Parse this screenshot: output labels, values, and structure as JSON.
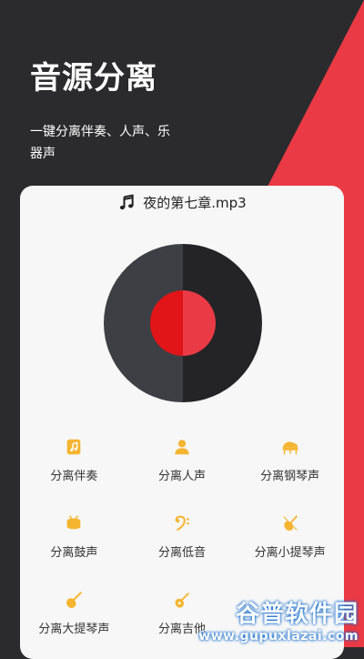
{
  "hero": {
    "title": "音源分离",
    "subtitle": "一键分离伴奏、人声、乐器声"
  },
  "file": {
    "icon": "music-note-icon",
    "name": "夜的第七章.mp3"
  },
  "options": [
    {
      "label": "分离伴奏",
      "icon": "music-file-icon"
    },
    {
      "label": "分离人声",
      "icon": "person-icon"
    },
    {
      "label": "分离钢琴声",
      "icon": "piano-icon"
    },
    {
      "label": "分离鼓声",
      "icon": "drum-icon"
    },
    {
      "label": "分离低音",
      "icon": "bass-clef-icon"
    },
    {
      "label": "分离小提琴声",
      "icon": "violin-icon"
    },
    {
      "label": "分离大提琴声",
      "icon": "cello-icon"
    },
    {
      "label": "分离吉他",
      "icon": "guitar-icon"
    }
  ],
  "watermark": {
    "name": "谷普软件园",
    "url": "www.gupuxlazai.com"
  },
  "colors": {
    "accent_red": "#ea3a45",
    "dark_bg": "#2b2b2d",
    "icon_yellow": "#f5b530"
  }
}
